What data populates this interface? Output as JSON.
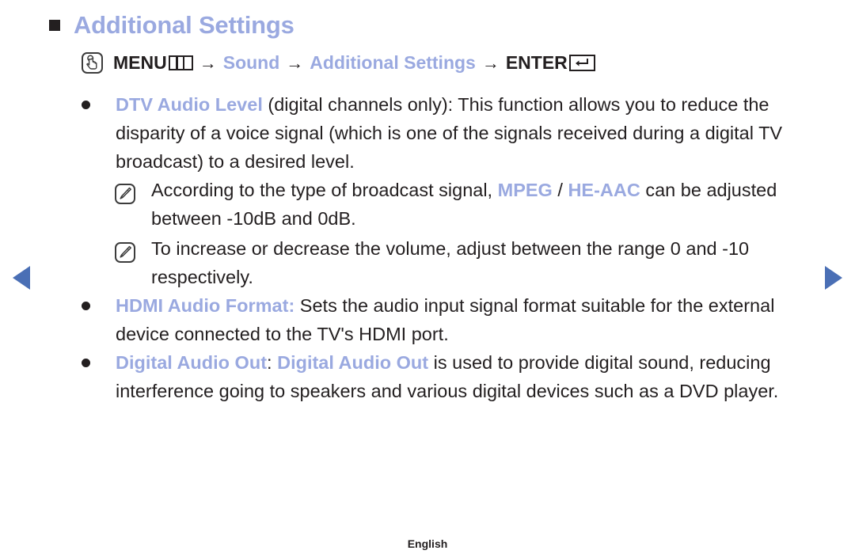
{
  "page": {
    "title": "Additional Settings",
    "footer_language": "English"
  },
  "menu_path": {
    "hand_icon": "hand-press-icon",
    "menu_label": "MENU",
    "menu_cols_icon": "menu-columns-icon",
    "arrow": "→",
    "sound_label": "Sound",
    "additional_settings_label": "Additional Settings",
    "enter_label": "ENTER",
    "enter_key_icon": "enter-key-icon"
  },
  "items": [
    {
      "keyword": "DTV Audio Level",
      "rest": " (digital channels only): This function allows you to reduce the disparity of a voice signal (which is one of the signals received during a digital TV broadcast) to a desired level.",
      "notes": [
        {
          "icon": "note-pencil-icon",
          "pre": "According to the type of broadcast signal, ",
          "kw1": "MPEG",
          "sep": " / ",
          "kw2": "HE-AAC",
          "post": " can be adjusted between -10dB and 0dB."
        },
        {
          "icon": "note-pencil-icon",
          "text": "To increase or decrease the volume, adjust between the range 0 and -10 respectively."
        }
      ]
    },
    {
      "keyword": "HDMI Audio Format",
      "colon_colored": ":",
      "rest": " Sets the audio input signal format suitable for the external device connected to the TV's HDMI port."
    },
    {
      "keyword": "Digital Audio Out",
      "colon_plain": ": ",
      "keyword2": "Digital Audio Out",
      "rest": " is used to provide digital sound, reducing interference going to speakers and various digital devices such as a DVD player."
    }
  ],
  "navigation": {
    "prev_icon": "previous-page-arrow-icon",
    "next_icon": "next-page-arrow-icon"
  },
  "colors": {
    "accent_blue": "#9aa9e0",
    "nav_arrow_blue": "#4a6fb5",
    "text_dark": "#231f20"
  }
}
